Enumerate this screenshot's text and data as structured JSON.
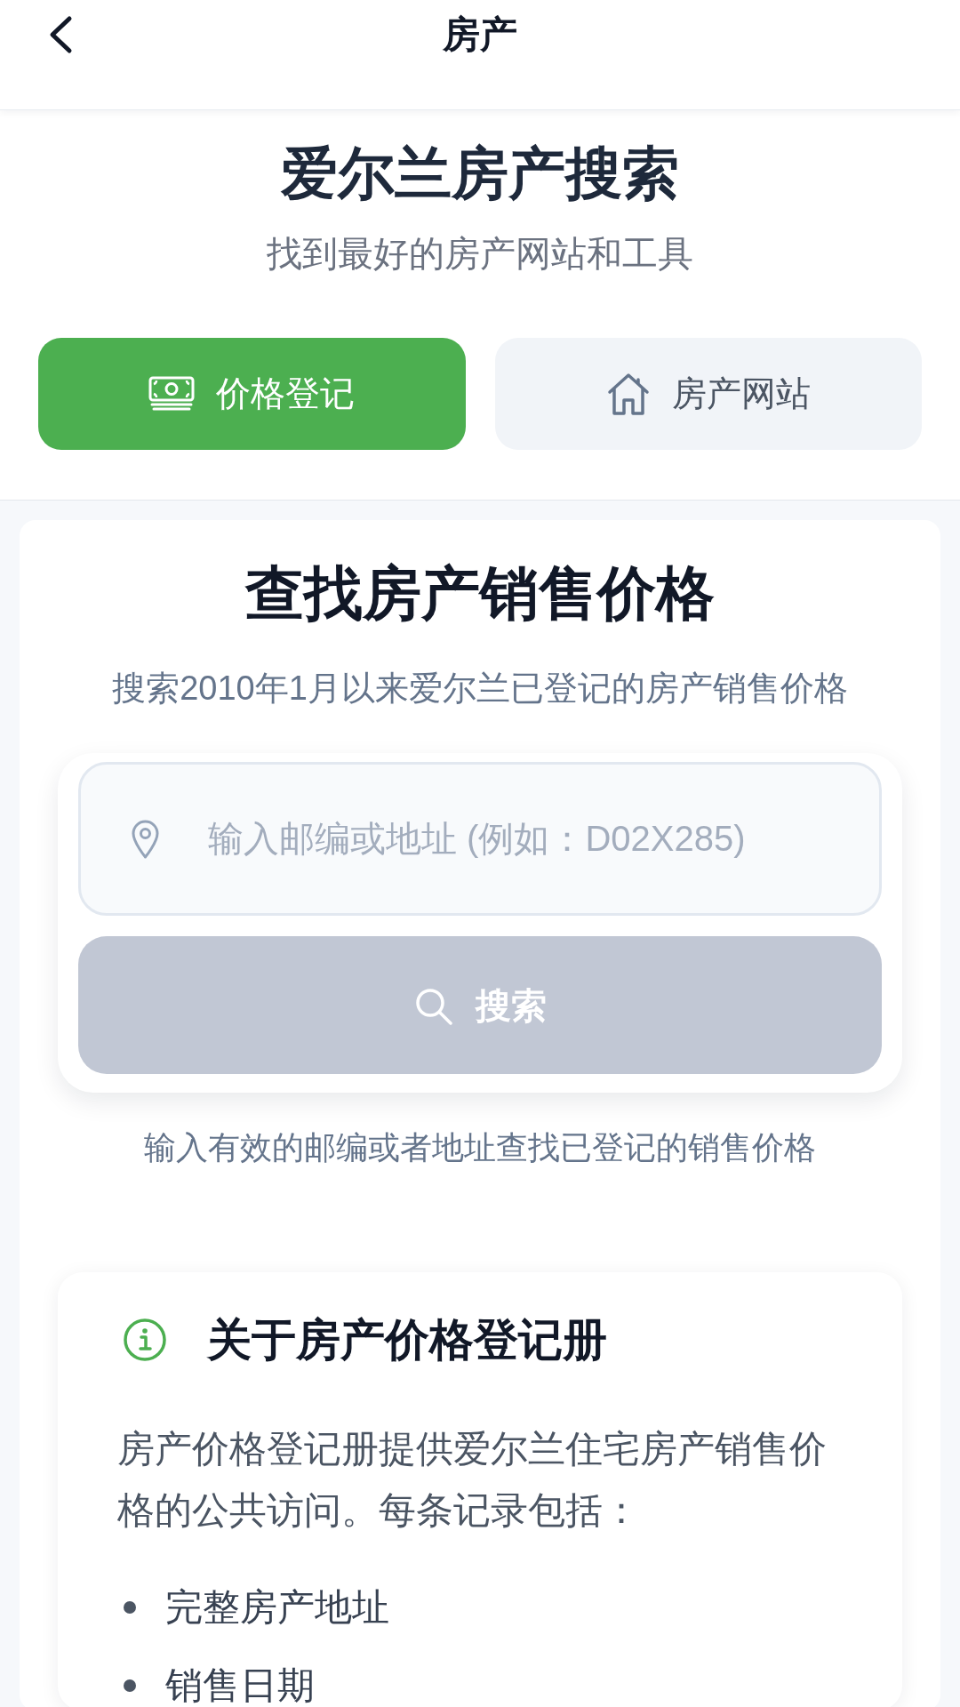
{
  "header": {
    "title": "房产"
  },
  "hero": {
    "title": "爱尔兰房产搜索",
    "subtitle": "找到最好的房产网站和工具"
  },
  "tabs": [
    {
      "label": "价格登记",
      "selected": true
    },
    {
      "label": "房产网站",
      "selected": false
    }
  ],
  "search_card": {
    "title": "查找房产销售价格",
    "subtitle": "搜索2010年1月以来爱尔兰已登记的房产销售价格",
    "address_field": {
      "placeholder": "输入邮编或地址 (例如：D02X285)"
    },
    "search_button": {
      "label": "搜索",
      "disabled": true
    },
    "hint": "输入有效的邮编或者地址查找已登记的销售价格"
  },
  "info_card": {
    "title": "关于房产价格登记册",
    "body": "房产价格登记册提供爱尔兰住宅房产销售价格的公共访问。每条记录包括：",
    "bullets": [
      "完整房产地址",
      "销售日期"
    ]
  }
}
